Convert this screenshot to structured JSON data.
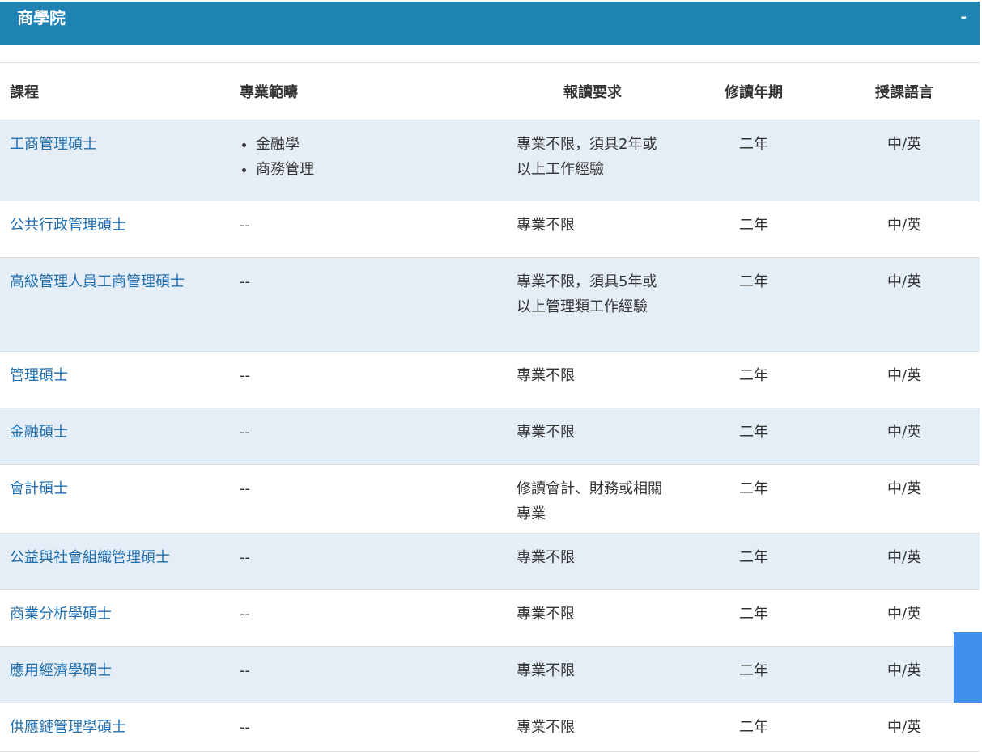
{
  "section": {
    "title": "商學院",
    "toggle": "-"
  },
  "table": {
    "headers": {
      "course": "課程",
      "field": "專業範疇",
      "requirement": "報讀要求",
      "duration": "修讀年期",
      "language": "授課語言"
    },
    "rows": [
      {
        "course": "工商管理碩士",
        "field": [
          "金融學",
          "商務管理"
        ],
        "requirement": "專業不限，須具2年或以上工作經驗",
        "duration": "二年",
        "language": "中/英"
      },
      {
        "course": "公共行政管理碩士",
        "field": "--",
        "requirement": "專業不限",
        "duration": "二年",
        "language": "中/英"
      },
      {
        "course": "高級管理人員工商管理碩士",
        "field": "--",
        "requirement": "專業不限，須具5年或以上管理類工作經驗",
        "duration": "二年",
        "language": "中/英"
      },
      {
        "course": "管理碩士",
        "field": "--",
        "requirement": "專業不限",
        "duration": "二年",
        "language": "中/英"
      },
      {
        "course": "金融碩士",
        "field": "--",
        "requirement": "專業不限",
        "duration": "二年",
        "language": "中/英"
      },
      {
        "course": "會計碩士",
        "field": "--",
        "requirement": "修讀會計、財務或相關專業",
        "duration": "二年",
        "language": "中/英"
      },
      {
        "course": "公益與社會組織管理碩士",
        "field": "--",
        "requirement": "專業不限",
        "duration": "二年",
        "language": "中/英"
      },
      {
        "course": "商業分析學碩士",
        "field": "--",
        "requirement": "專業不限",
        "duration": "二年",
        "language": "中/英"
      },
      {
        "course": "應用經濟學碩士",
        "field": "--",
        "requirement": "專業不限",
        "duration": "二年",
        "language": "中/英"
      },
      {
        "course": "供應鏈管理學碩士",
        "field": "--",
        "requirement": "專業不限",
        "duration": "二年",
        "language": "中/英"
      }
    ]
  },
  "colors": {
    "header_bg": "#1f84b4",
    "row_alt_bg": "#e5eef7",
    "link": "#1f6fb0",
    "scroll_button": "#4090f0"
  }
}
